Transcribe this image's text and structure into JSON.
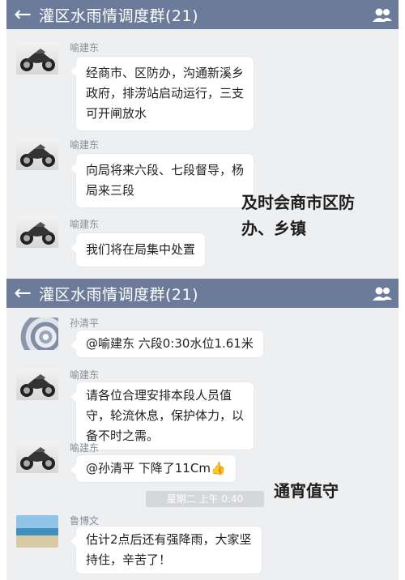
{
  "panel1": {
    "header": {
      "title": "灌区水雨情调度群(21)",
      "back_icon": "back-arrow-icon",
      "group_icon": "group-members-icon"
    },
    "messages": [
      {
        "sender": "喻建东",
        "avatar": "motorcycle-avatar",
        "lines": [
          "经商市、区防办，沟通新溪乡",
          "政府，排涝站启动运行，三支",
          "可开闸放水"
        ]
      },
      {
        "sender": "喻建东",
        "avatar": "motorcycle-avatar",
        "lines": [
          "向局将来六段、七段督导，杨",
          "局来三段"
        ]
      },
      {
        "sender": "喻建东",
        "avatar": "motorcycle-avatar",
        "lines": [
          "我们将在局集中处置"
        ]
      }
    ],
    "caption_lines": [
      "及时会商市区防",
      "办、乡镇"
    ]
  },
  "panel2": {
    "header": {
      "title": "灌区水雨情调度群(21)",
      "back_icon": "back-arrow-icon",
      "group_icon": "group-members-icon"
    },
    "messages": [
      {
        "sender": "孙清平",
        "avatar": "spiral-avatar",
        "lines": [
          "@喻建东 六段0:30水位1.61米"
        ]
      },
      {
        "sender": "喻建东",
        "avatar": "motorcycle-avatar",
        "lines": [
          "请各位合理安排本段人员值",
          "守，轮流休息，保护体力，以",
          "备不时之需。"
        ]
      },
      {
        "sender": "喻建东",
        "avatar": "motorcycle-avatar",
        "lines": [
          "@孙清平  下降了11Cm"
        ],
        "emoji": "👍"
      },
      {
        "sender": "鲁博文",
        "avatar": "sea-avatar",
        "lines": [
          "估计2点后还有强降雨，大家坚",
          "持住，辛苦了！"
        ]
      }
    ],
    "timestamp": "星期二 上午 0:40",
    "caption": "通宵值守"
  }
}
